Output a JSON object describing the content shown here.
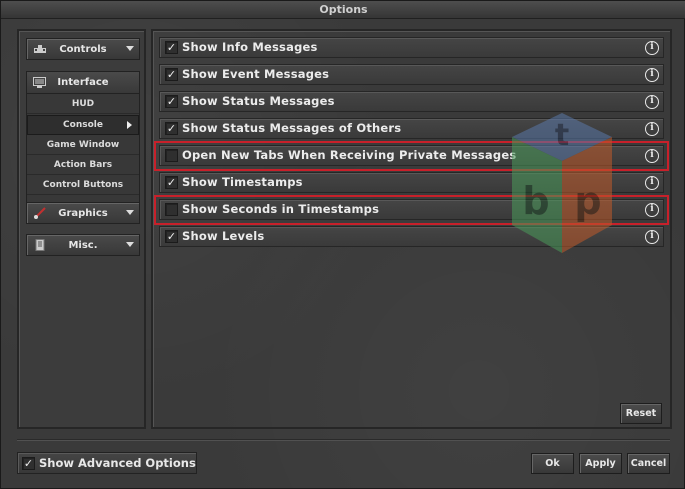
{
  "window": {
    "title": "Options"
  },
  "sidebar": {
    "controls": {
      "label": "Controls",
      "icon": "gamepad-icon"
    },
    "interface": {
      "label": "Interface",
      "icon": "monitor-icon",
      "items": [
        {
          "label": "HUD",
          "active": false
        },
        {
          "label": "Console",
          "active": true
        },
        {
          "label": "Game Window",
          "active": false
        },
        {
          "label": "Action Bars",
          "active": false
        },
        {
          "label": "Control Buttons",
          "active": false
        }
      ]
    },
    "graphics": {
      "label": "Graphics",
      "icon": "brush-icon"
    },
    "misc": {
      "label": "Misc.",
      "icon": "scroll-icon"
    }
  },
  "options": [
    {
      "label": "Show Info Messages",
      "checked": true
    },
    {
      "label": "Show Event Messages",
      "checked": true
    },
    {
      "label": "Show Status Messages",
      "checked": true
    },
    {
      "label": "Show Status Messages of Others",
      "checked": true
    },
    {
      "label": "Open New Tabs When Receiving Private Messages",
      "checked": false
    },
    {
      "label": "Show Timestamps",
      "checked": true
    },
    {
      "label": "Show Seconds in Timestamps",
      "checked": false
    },
    {
      "label": "Show Levels",
      "checked": true
    }
  ],
  "info_symbol": "i",
  "check_symbol": "✓",
  "logo_letters": {
    "top": "t",
    "left": "b",
    "right": "p"
  },
  "buttons": {
    "reset": "Reset",
    "ok": "Ok",
    "apply": "Apply",
    "cancel": "Cancel"
  },
  "advanced": {
    "label": "Show Advanced Options",
    "checked": true
  },
  "colors": {
    "highlight": "#c8202a",
    "background": "#3a3a3a"
  }
}
